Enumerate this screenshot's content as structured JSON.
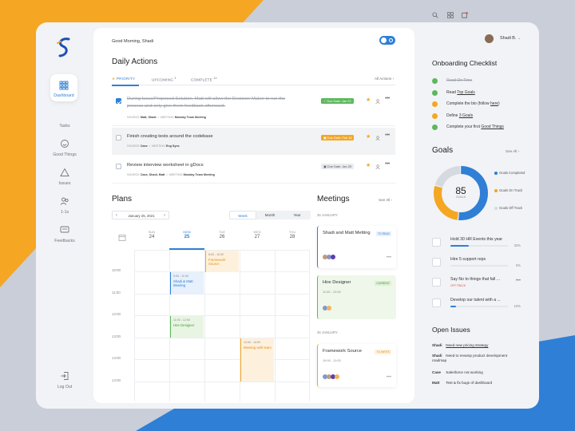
{
  "colors": {
    "accent": "#2f7fd6",
    "green": "#5cb85c",
    "orange": "#f5a623",
    "red": "#e0503c"
  },
  "sidebar": {
    "items": [
      {
        "label": "Dashboard",
        "icon": "grid-icon"
      },
      {
        "label": "Tasks",
        "icon": "check-circle-icon"
      },
      {
        "label": "Good Things",
        "icon": "smile-icon"
      },
      {
        "label": "Issues",
        "icon": "warning-icon"
      },
      {
        "label": "1-1s",
        "icon": "people-icon"
      },
      {
        "label": "Feedbacks",
        "icon": "message-icon"
      }
    ],
    "logout": "Log Out"
  },
  "header": {
    "greeting": "Good Morning, Shadi",
    "user_name": "Shadi B."
  },
  "daily": {
    "title": "Daily Actions",
    "tabs": [
      {
        "label": "PRIORITY",
        "count": ""
      },
      {
        "label": "UPCOMING",
        "count": "3"
      },
      {
        "label": "COMPLETE",
        "count": "14"
      }
    ],
    "all_actions": "All Actions",
    "tasks": [
      {
        "title": "During Issue/Proposed Solution, Matt will allow the Decision-Maker to run the process and only give them feedback afterward.",
        "source_k": "SOURCE",
        "source_v": "Matt, Shadi",
        "meet_k": "MEETING",
        "meet_v": "Monday Team Meeting",
        "due": "Due Date: Jan 22",
        "done": true,
        "status": "green"
      },
      {
        "title": "Finish creating tests around the codebase",
        "source_k": "SOURCE",
        "source_v": "Case",
        "meet_k": "MEETING",
        "meet_v": "Eng Sync",
        "due": "Due Date: Feb 18",
        "done": false,
        "status": "orange"
      },
      {
        "title": "Review interview worksheet in gDocs",
        "source_k": "SOURCE",
        "source_v": "Case, Shadi, Matt",
        "meet_k": "MEETING",
        "meet_v": "Monday Team Meeting",
        "due": "Due Date: Jan 25",
        "done": false,
        "status": "neutral"
      }
    ]
  },
  "plans": {
    "title": "Plans",
    "date": "January 25, 2021",
    "views": [
      "Week",
      "Month",
      "Year"
    ],
    "days": [
      {
        "dow": "SUN",
        "d": "24"
      },
      {
        "dow": "MON",
        "d": "25"
      },
      {
        "dow": "TUE",
        "d": "26"
      },
      {
        "dow": "WED",
        "d": "27"
      },
      {
        "dow": "THU",
        "d": "28"
      }
    ],
    "times": [
      "10:00",
      "11:00",
      "12:00",
      "13:00",
      "14:00"
    ],
    "events": [
      {
        "time": "8:00 - 10:00",
        "title": "Framework Source"
      },
      {
        "time": "9:00 - 11:00",
        "title": "Shadi & Matt Meeting"
      },
      {
        "time": "11:00 - 12:00",
        "title": "Hire Designer"
      },
      {
        "time": "12:00 - 14:00",
        "title": "Meeting with team"
      }
    ]
  },
  "meetings": {
    "title": "Meetings",
    "see_all": "See All",
    "date1": "25 JANUARY",
    "date2": "26 JANUARY",
    "items": [
      {
        "title": "Shadi and Matt Metting",
        "tag": "TO READ",
        "time": ""
      },
      {
        "title": "Hire Designer",
        "tag": "CURRENT",
        "time": "11:00 - 12:00"
      },
      {
        "title": "Framework Source",
        "tag": "TO WRITE",
        "time": "10:00 - 11:00"
      }
    ]
  },
  "onboarding": {
    "title": "Onboarding Checklist",
    "items": [
      {
        "pre": "Read On Time",
        "link": "",
        "post": "",
        "state": "done"
      },
      {
        "pre": "Read ",
        "link": "Top Goals",
        "post": "",
        "state": "done"
      },
      {
        "pre": "Complete the bio (follow ",
        "link": "here",
        "post": ")",
        "state": "todo"
      },
      {
        "pre": "Define ",
        "link": "3 Goals",
        "post": "",
        "state": "todo"
      },
      {
        "pre": "Complete your first ",
        "link": "Good Things",
        "post": "",
        "state": "done"
      }
    ]
  },
  "goals": {
    "title": "Goals",
    "see_all": "See All",
    "total": "85",
    "total_label": "GOALS",
    "legend": [
      "Goals Completed",
      "Goals On Track",
      "Goals Off Track"
    ],
    "donut": [
      {
        "value": 52,
        "color": "#2f7fd6"
      },
      {
        "value": 28,
        "color": "#f5a623"
      },
      {
        "value": 20,
        "color": "#d5d9e0"
      }
    ],
    "items": [
      {
        "title": "Hold 30 HR Events this year",
        "pct": "32%",
        "progress": 0.32,
        "status": "",
        "icon": "calendar-icon"
      },
      {
        "title": "Hire 5 support reps",
        "pct": "0%",
        "progress": 0,
        "status": "",
        "icon": "briefcase-icon"
      },
      {
        "title": "Say No to things that fall ...",
        "pct": "",
        "progress": 0,
        "status": "OFF TRACK",
        "icon": "lock-icon"
      },
      {
        "title": "Develop our talent with a ...",
        "pct": "10%",
        "progress": 0.1,
        "status": "",
        "icon": "person-icon"
      }
    ]
  },
  "issues": {
    "title": "Open Issues",
    "items": [
      {
        "who": "Shadi",
        "text": "Need new pricing strategy",
        "link": true
      },
      {
        "who": "Shadi",
        "text": "Need to revamp product development roadmap",
        "link": false
      },
      {
        "who": "Case",
        "text": "Salesforce not working",
        "link": false
      },
      {
        "who": "Matt",
        "text": "Test & fix bugs of dashboard",
        "link": false
      }
    ]
  }
}
